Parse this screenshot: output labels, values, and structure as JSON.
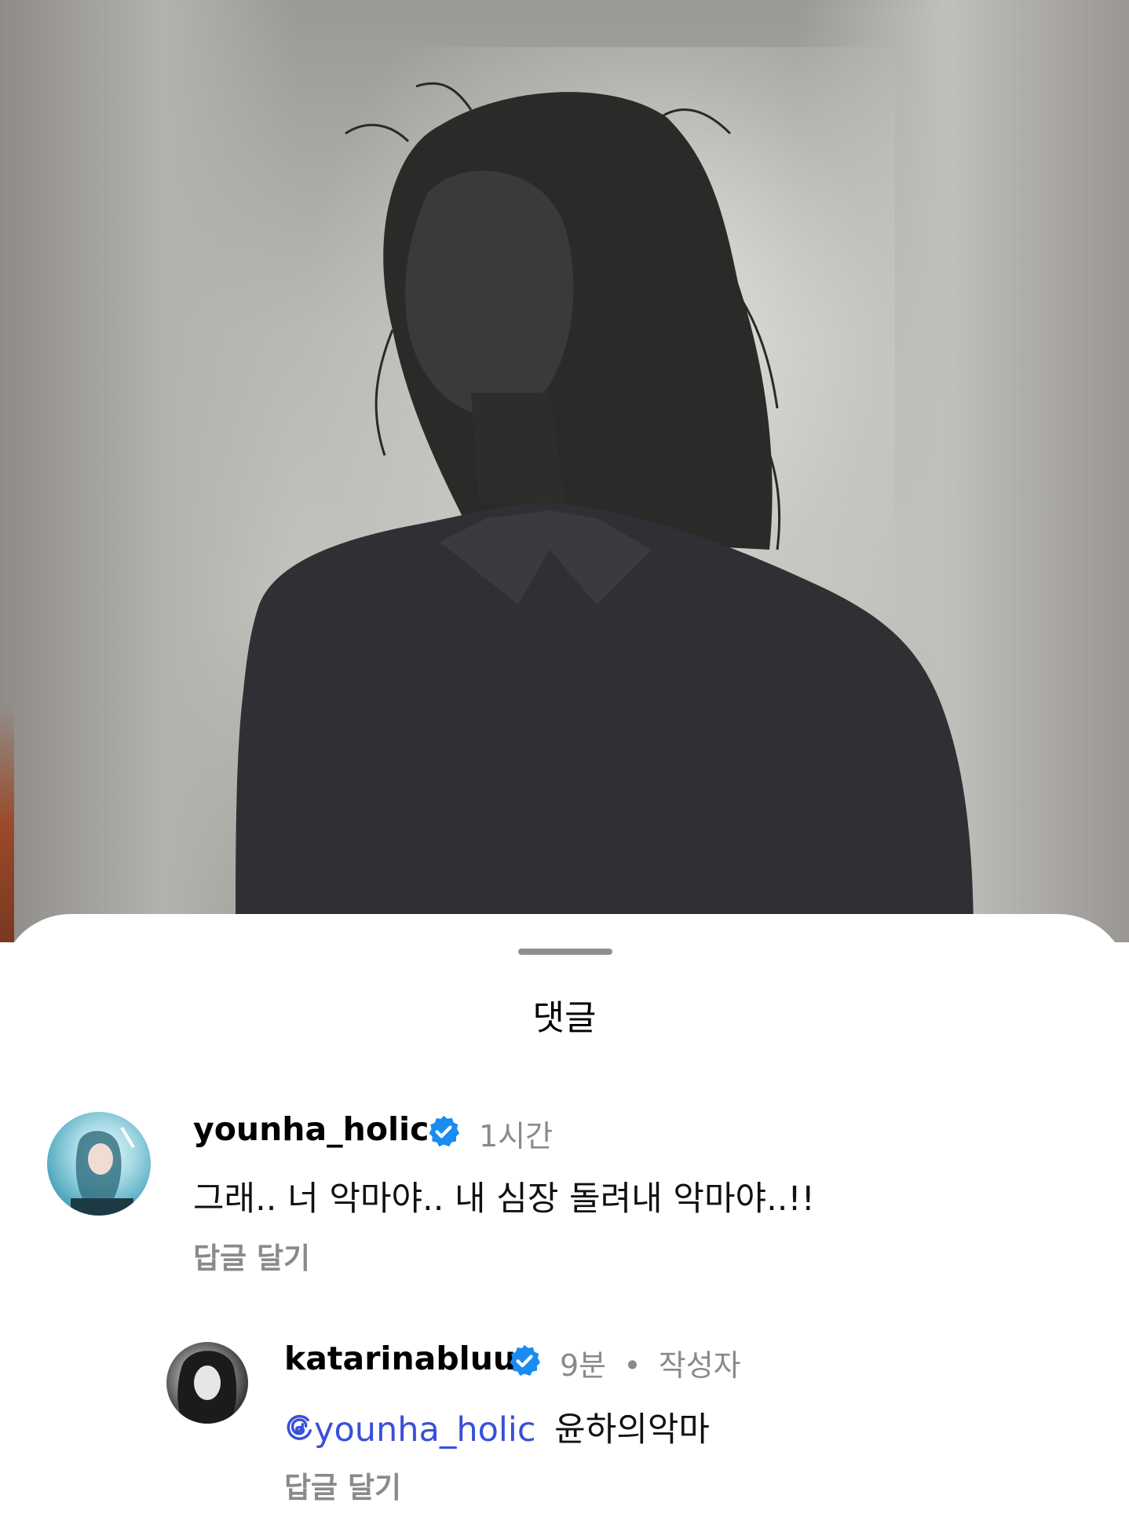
{
  "sheet": {
    "title": "댓글"
  },
  "comments": [
    {
      "username": "younha_holic",
      "verified": true,
      "time": "1시간",
      "text": "그래.. 너 악마야.. 내 심장 돌려내 악마야..!!",
      "reply_label": "답글 달기"
    },
    {
      "username": "katarinabluu",
      "verified": true,
      "time": "9분",
      "separator": "•",
      "author_tag": "작성자",
      "mention": "younha_holic",
      "text": "윤하의악마",
      "reply_label": "답글 달기"
    }
  ],
  "colors": {
    "verified_badge": "#1a8cf0",
    "mention": "#3a4fd8",
    "secondary_text": "#8a8a8a"
  },
  "icons": [
    "verified-badge-icon",
    "threads-mention-icon",
    "avatar"
  ]
}
